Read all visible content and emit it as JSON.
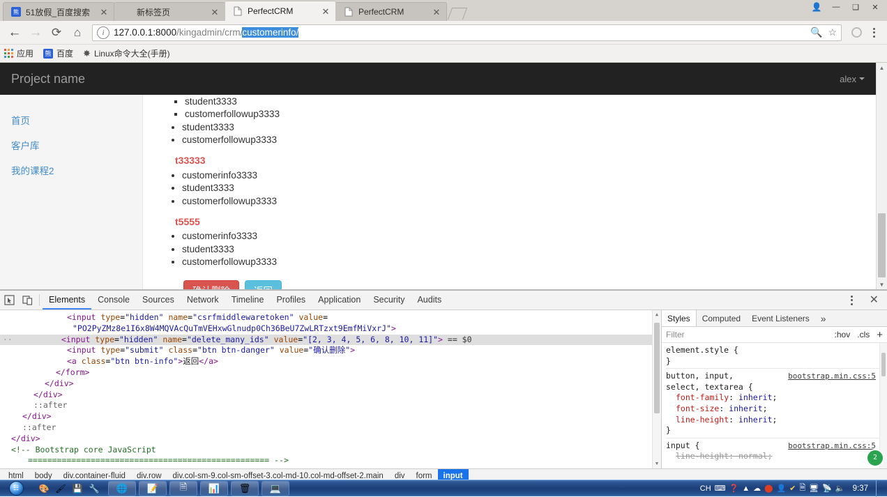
{
  "browser": {
    "tabs": [
      {
        "title": "51放假_百度搜索",
        "favicon": "baidu-icon",
        "active": false
      },
      {
        "title": "新标签页",
        "favicon": "blank-icon",
        "active": false
      },
      {
        "title": "PerfectCRM",
        "favicon": "page-icon",
        "active": true
      },
      {
        "title": "PerfectCRM",
        "favicon": "page-icon",
        "active": false
      }
    ],
    "window_controls": [
      "person-icon",
      "minimize-icon",
      "maximize-icon",
      "close-icon"
    ],
    "nav": {
      "back": "←",
      "forward": "→",
      "reload": "⟳",
      "home": "⌂"
    },
    "omnibox": {
      "info_icon": "info-icon",
      "url_host": "127.0.0.1:8000",
      "url_path_dim": "/kingadmin/crm/",
      "url_selected": "customerinfo/",
      "zoom_icon": "zoom-out-icon",
      "star_icon": "bookmark-star-icon"
    },
    "profile_icon": "profile-circle-icon",
    "menu_icon": "kebab-menu-icon",
    "bookmarks": [
      {
        "label": "应用",
        "icon": "apps-grid-icon"
      },
      {
        "label": "百度",
        "icon": "baidu-icon"
      },
      {
        "label": "Linux命令大全(手册)",
        "icon": "link-icon"
      }
    ]
  },
  "site": {
    "brand": "Project name",
    "user": "alex",
    "sidebar": [
      {
        "label": "首页"
      },
      {
        "label": "客户库"
      },
      {
        "label": "我的课程2"
      }
    ],
    "content": {
      "top_sub_items": [
        "student3333",
        "customerfollowup3333"
      ],
      "top_items": [
        "student3333",
        "customerfollowup3333"
      ],
      "groups": [
        {
          "title": "t33333",
          "items": [
            "customerinfo3333",
            "student3333",
            "customerfollowup3333"
          ]
        },
        {
          "title": "t5555",
          "items": [
            "customerinfo3333",
            "student3333",
            "customerfollowup3333"
          ]
        }
      ],
      "buttons": {
        "confirm_delete": "确认删除",
        "back": "返回"
      }
    },
    "colors": {
      "danger": "#d9534f",
      "info": "#5bc0de",
      "link": "#428bca",
      "navbar": "#222222"
    }
  },
  "devtools": {
    "toolbar_icons": [
      "inspect-element-icon",
      "device-toolbar-icon"
    ],
    "tabs": [
      {
        "label": "Elements",
        "active": true
      },
      {
        "label": "Console",
        "active": false
      },
      {
        "label": "Sources",
        "active": false
      },
      {
        "label": "Network",
        "active": false
      },
      {
        "label": "Timeline",
        "active": false
      },
      {
        "label": "Profiles",
        "active": false
      },
      {
        "label": "Application",
        "active": false
      },
      {
        "label": "Security",
        "active": false
      },
      {
        "label": "Audits",
        "active": false
      }
    ],
    "more_icon": "kebab-menu-icon",
    "close_icon": "close-icon",
    "dom": {
      "lines": [
        {
          "indent": 7,
          "kind": "partial",
          "text": "<input type=\"hidden\" name=\"csrfmiddlewaretoken\" value="
        },
        {
          "indent": 8,
          "kind": "value",
          "text": "\"PO2PyZMz8e1I6x8W4MQVAcQuTmVEHxwGlnudp0Ch36BeU7ZwLRTzxt9EmfMiVxrJ\">"
        },
        {
          "indent": 7,
          "kind": "selected",
          "text": "<input type=\"hidden\" name=\"delete_many_ids\" value=\"[2, 3, 4, 5, 6, 8, 10, 11]\"> == $0"
        },
        {
          "indent": 7,
          "kind": "tag",
          "text": "<input type=\"submit\" class=\"btn btn-danger\" value=\"确认删除\">"
        },
        {
          "indent": 7,
          "kind": "anchor",
          "text": "<a class=\"btn btn-info\">返回</a>"
        },
        {
          "indent": 6,
          "kind": "close",
          "text": "</form>"
        },
        {
          "indent": 5,
          "kind": "close",
          "text": "</div>"
        },
        {
          "indent": 4,
          "kind": "close",
          "text": "</div>"
        },
        {
          "indent": 4,
          "kind": "pseudo",
          "text": "::after"
        },
        {
          "indent": 3,
          "kind": "close",
          "text": "</div>"
        },
        {
          "indent": 3,
          "kind": "pseudo",
          "text": "::after"
        },
        {
          "indent": 2,
          "kind": "close",
          "text": "</div>"
        },
        {
          "indent": 2,
          "kind": "comment",
          "text": "<!-- Bootstrap core JavaScript"
        },
        {
          "indent": 3,
          "kind": "comment",
          "text": "================================================== -->"
        }
      ]
    },
    "styles": {
      "tabs": [
        {
          "label": "Styles",
          "active": true
        },
        {
          "label": "Computed",
          "active": false
        },
        {
          "label": "Event Listeners",
          "active": false
        }
      ],
      "more": "»",
      "filter_placeholder": "Filter",
      "hov_label": ":hov",
      "cls_label": ".cls",
      "plus_label": "+",
      "rules": [
        {
          "selector": "element.style {",
          "source": "",
          "declarations": [],
          "close": "}"
        },
        {
          "selector": "button, input,\nselect, textarea {",
          "source": "bootstrap.min.css:5",
          "declarations": [
            {
              "prop": "font-family",
              "value": "inherit",
              "struck": false
            },
            {
              "prop": "font-size",
              "value": "inherit",
              "struck": false
            },
            {
              "prop": "line-height",
              "value": "inherit",
              "struck": false
            }
          ],
          "close": "}"
        },
        {
          "selector": "input {",
          "source": "bootstrap.min.css:5",
          "declarations": [
            {
              "prop": "line-height",
              "value": "normal",
              "struck": true
            }
          ],
          "close": ""
        }
      ],
      "badge": "2"
    },
    "breadcrumbs": [
      {
        "label": "html",
        "active": false
      },
      {
        "label": "body",
        "active": false
      },
      {
        "label": "div.container-fluid",
        "active": false
      },
      {
        "label": "div.row",
        "active": false
      },
      {
        "label": "div.col-sm-9.col-sm-offset-3.col-md-10.col-md-offset-2.main",
        "active": false
      },
      {
        "label": "div",
        "active": false
      },
      {
        "label": "form",
        "active": false
      },
      {
        "label": "input",
        "active": true
      }
    ]
  },
  "taskbar": {
    "start": "start-orb-icon",
    "quick_launch": [
      "paint-icon",
      "media-icon",
      "save-icon",
      "tool-icon"
    ],
    "windows": [
      "chrome-icon",
      "notepad-icon",
      "word-icon",
      "powerpoint-icon",
      "recycle-icon",
      "pc-icon"
    ],
    "tray": [
      "CH",
      "keyboard-icon",
      "help-icon",
      "expand-icon",
      "cloud-icon",
      "red-dot-icon",
      "user-icon",
      "shield-icon",
      "copy-icon",
      "screen-icon",
      "network-icon",
      "volume-icon"
    ],
    "language": "CH",
    "clock": "9:37"
  }
}
